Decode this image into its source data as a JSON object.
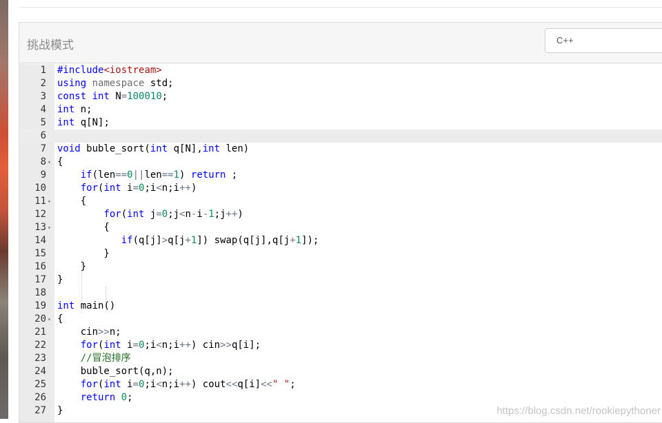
{
  "panel": {
    "title": "挑战模式"
  },
  "language_select": {
    "value": "C++"
  },
  "editor": {
    "active_line": 6,
    "lines": [
      {
        "n": "1",
        "fold": "",
        "code": "#include<iostream>"
      },
      {
        "n": "2",
        "fold": "",
        "code": "using namespace std;"
      },
      {
        "n": "3",
        "fold": "",
        "code": "const int N=100010;"
      },
      {
        "n": "4",
        "fold": "",
        "code": "int n;"
      },
      {
        "n": "5",
        "fold": "",
        "code": "int q[N];"
      },
      {
        "n": "6",
        "fold": "",
        "code": ""
      },
      {
        "n": "7",
        "fold": "",
        "code": "void buble_sort(int q[N],int len)"
      },
      {
        "n": "8",
        "fold": "▾",
        "code": "{"
      },
      {
        "n": "9",
        "fold": "",
        "code": "    if(len==0||len==1) return ;"
      },
      {
        "n": "10",
        "fold": "",
        "code": "    for(int i=0;i<n;i++)"
      },
      {
        "n": "11",
        "fold": "▾",
        "code": "    {"
      },
      {
        "n": "12",
        "fold": "",
        "code": "        for(int j=0;j<n-i-1;j++)"
      },
      {
        "n": "13",
        "fold": "▾",
        "code": "        {"
      },
      {
        "n": "14",
        "fold": "",
        "code": "           if(q[j]>q[j+1]) swap(q[j],q[j+1]);"
      },
      {
        "n": "15",
        "fold": "",
        "code": "        }"
      },
      {
        "n": "16",
        "fold": "",
        "code": "    }"
      },
      {
        "n": "17",
        "fold": "",
        "code": "}"
      },
      {
        "n": "18",
        "fold": "",
        "code": ""
      },
      {
        "n": "19",
        "fold": "",
        "code": "int main()"
      },
      {
        "n": "20",
        "fold": "▾",
        "code": "{"
      },
      {
        "n": "21",
        "fold": "",
        "code": "    cin>>n;"
      },
      {
        "n": "22",
        "fold": "",
        "code": "    for(int i=0;i<n;i++) cin>>q[i];"
      },
      {
        "n": "23",
        "fold": "",
        "code": "    //冒泡排序"
      },
      {
        "n": "24",
        "fold": "",
        "code": "    buble_sort(q,n);"
      },
      {
        "n": "25",
        "fold": "",
        "code": "    for(int i=0;i<n;i++) cout<<q[i]<<\" \";"
      },
      {
        "n": "26",
        "fold": "",
        "code": "    return 0;"
      },
      {
        "n": "27",
        "fold": "",
        "code": "}"
      }
    ]
  },
  "watermark": "https://blog.csdn.net/rookiepythoner"
}
